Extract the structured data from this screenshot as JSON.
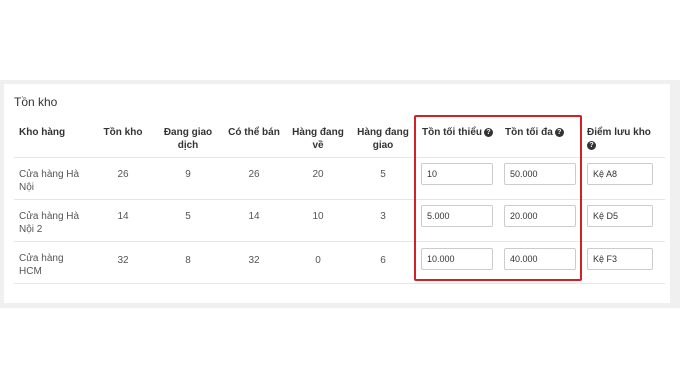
{
  "title": "Tồn kho",
  "columns": {
    "warehouse": "Kho hàng",
    "stock": "Tồn kho",
    "in_transaction": "Đang giao dịch",
    "available": "Có thể bán",
    "incoming": "Hàng đang về",
    "delivering": "Hàng đang giao",
    "min_stock": "Tồn tối thiểu",
    "max_stock": "Tồn tối đa",
    "location": "Điểm lưu kho"
  },
  "help_glyph": "?",
  "rows": [
    {
      "warehouse": "Cửa hàng Hà Nội",
      "stock": "26",
      "in_transaction": "9",
      "available": "26",
      "incoming": "20",
      "delivering": "5",
      "min_stock": "10",
      "max_stock": "50.000",
      "location": "Kệ A8"
    },
    {
      "warehouse": "Cửa hàng Hà Nội 2",
      "stock": "14",
      "in_transaction": "5",
      "available": "14",
      "incoming": "10",
      "delivering": "3",
      "min_stock": "5.000",
      "max_stock": "20.000",
      "location": "Kệ D5"
    },
    {
      "warehouse": "Cửa hàng HCM",
      "stock": "32",
      "in_transaction": "8",
      "available": "32",
      "incoming": "0",
      "delivering": "6",
      "min_stock": "10.000",
      "max_stock": "40.000",
      "location": "Kệ F3"
    }
  ],
  "colors": {
    "highlight_border": "#d32027",
    "panel_background": "#f0f0f0"
  }
}
